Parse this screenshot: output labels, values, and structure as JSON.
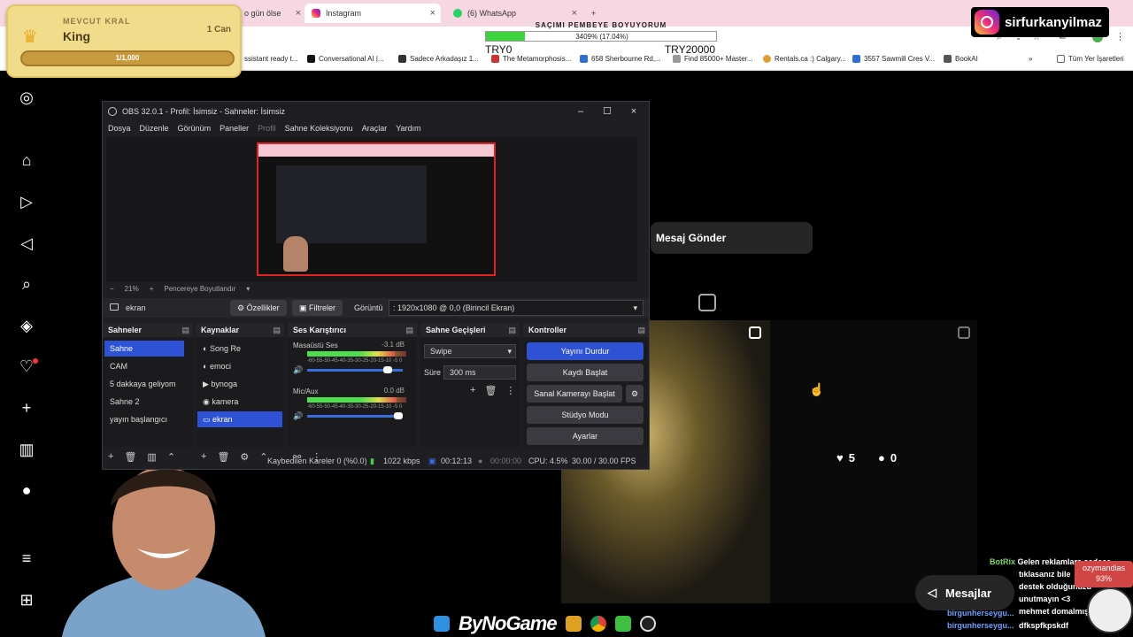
{
  "browser": {
    "tabs": [
      {
        "label": "o gün ölse",
        "close": "×"
      },
      {
        "label": "Instagram",
        "close": "×"
      },
      {
        "label": "(6) WhatsApp",
        "close": "×"
      }
    ],
    "new_tab": "+",
    "bookmarks": [
      "ssistant ready t...",
      "Conversational AI |...",
      "Sadece Arkadaşız 1...",
      "The Metamorphosis...",
      "658 Sherbourne Rd,...",
      "Find 85000+ Master...",
      "Rentals.ca :) Calgary...",
      "3557 Sawmill Cres V...",
      "BookAI"
    ],
    "more": "»",
    "all_bookmarks": "Tüm Yer İşaretleri"
  },
  "overlays": {
    "king": {
      "label": "MEVCUT KRAL",
      "name": "King",
      "lives": "1 Can",
      "progress_text": "1/1,000",
      "progress": 0.001
    },
    "goal": {
      "title": "SAÇIMI PEMBEYE BOYUYORUM",
      "percent_text": "3409% (17.04%)",
      "fraction": 0.1704,
      "min": "TRY0",
      "max": "TRY20000"
    },
    "handle": "sirfurkanyilmaz"
  },
  "instagram": {
    "send_message": "Mesaj Gönder",
    "likes": "5",
    "comments": "0",
    "messages": "Mesajlar",
    "sidebar_icons": [
      "instagram-icon",
      "home-icon",
      "reels-icon",
      "messages-icon",
      "search-icon",
      "explore-icon",
      "notifications-icon",
      "create-icon",
      "dashboard-icon",
      "profile-icon",
      "menu-icon",
      "more-icon"
    ]
  },
  "chat": {
    "rows": [
      {
        "user": "BotRix",
        "text": "Gelen reklamlara sadece"
      },
      {
        "user": "",
        "text": "tıklasanız bile"
      },
      {
        "user": "",
        "text": "destek olduğunuzu"
      },
      {
        "user": "",
        "text": "unutmayın <3"
      },
      {
        "user": "",
        "text": "mehmet domalmış"
      },
      {
        "user": "birgunherseygu...",
        "text": ""
      },
      {
        "user": "birgunherseygu...",
        "text": "dfkspfkpskdf"
      }
    ],
    "poll_name": "ozymandias",
    "poll_pct": "93%"
  },
  "taskbar": {
    "brand": "ByNoGame"
  },
  "obs": {
    "title": "OBS 32.0.1 - Profil: İsimsiz - Sahneler: İsimsiz",
    "menu": [
      "Dosya",
      "Düzenle",
      "Görünüm",
      "Paneller",
      "Profil",
      "Sahne Koleksiyonu",
      "Araçlar",
      "Yardım"
    ],
    "zoom": "21%",
    "fit": "Pencereye Boyutlandır",
    "source_name": "ekran",
    "properties": "Özellikler",
    "filters": "Filtreler",
    "display_label": "Görüntü",
    "display_value": ": 1920x1080 @ 0,0 (Birincil Ekran)",
    "scenes_title": "Sahneler",
    "scenes": [
      "Sahne",
      "CAM",
      "5 dakkaya geliyom",
      "Sahne 2",
      "yayın başlangıcı"
    ],
    "sources_title": "Kaynaklar",
    "sources": [
      "Song Re",
      "emoci",
      "bynoga",
      "kamera",
      "ekran"
    ],
    "mixer_title": "Ses Karıştırıcı",
    "mixer": [
      {
        "name": "Masaüstü Ses",
        "db": "-3.1 dB",
        "level": 0.88
      },
      {
        "name": "Mic/Aux",
        "db": "0.0 dB",
        "level": 0.9
      }
    ],
    "meter_scale": "-60-55-50-45-40-35-30-25-20-15-10 -5  0",
    "transitions_title": "Sahne Geçişleri",
    "transition": "Swipe",
    "duration_label": "Süre",
    "duration": "300 ms",
    "controls_title": "Kontroller",
    "controls": [
      "Yayını Durdur",
      "Kaydı Başlat",
      "Sanal Kamerayı Başlat",
      "Stüdyo Modu",
      "Ayarlar"
    ],
    "status": {
      "dropped": "Kaybedilen Kareler 0 (%0.0)",
      "bitrate": "1022 kbps",
      "stream_time": "00:12:13",
      "rec_time": "00:00:00",
      "cpu": "CPU: 4.5%",
      "fps": "30.00 / 30.00 FPS"
    }
  }
}
